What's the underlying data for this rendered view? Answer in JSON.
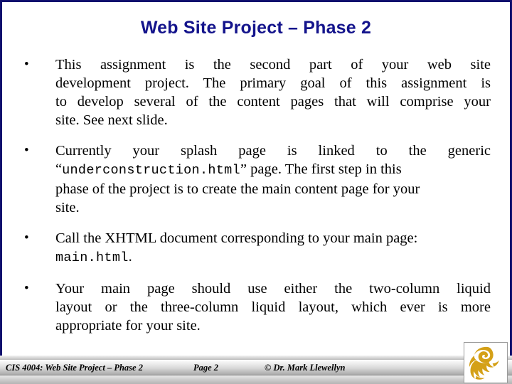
{
  "slide": {
    "title": "Web Site Project – Phase 2",
    "accent_color": "#14148c",
    "background_color": "#ffffff",
    "border_color": "#10106e",
    "bullet_glyph": "•",
    "bullets": [
      {
        "id": "bullet-1",
        "lines": [
          "This  assignment  is  the  second  part  of  your  web  site",
          "development project.  The primary goal of this assignment is",
          "to develop several of the content pages that will comprise your",
          "site.  See next slide."
        ],
        "plain": "This assignment is the second part of your web site development project.  The primary goal of this assignment is to develop several of the content pages that will comprise your site.  See next slide."
      },
      {
        "id": "bullet-2",
        "line1": "Currently  your  splash  page  is  linked  to  the  generic",
        "mono": "underconstruction.html",
        "line2_prefix": "“",
        "line2_suffix": "” page.  The first step in this",
        "line3": "phase of the project is to create the main content page for your",
        "line4": "site.",
        "plain": "Currently your splash page is linked to the generic “underconstruction.html” page.  The first step in this phase of the project is to create the main content page for your site."
      },
      {
        "id": "bullet-3",
        "line1": "Call the XHTML document corresponding to your main page:",
        "mono": "main.html",
        "line2_suffix": ".",
        "plain": "Call the XHTML document corresponding to your main page: main.html."
      },
      {
        "id": "bullet-4",
        "lines": [
          "Your  main  page  should  use  either  the  two-column  liquid",
          "layout or the three-column liquid layout, which ever is more",
          "appropriate for your site."
        ],
        "plain": "Your main page should use either the two-column liquid layout or the three-column liquid layout, which ever is more appropriate for your site."
      }
    ]
  },
  "footer": {
    "course": "CIS 4004: Web Site Project – Phase 2",
    "page": "Page 2",
    "copyright": "© Dr. Mark Llewellyn",
    "logo_name": "ucf-pegasus-logo",
    "logo_color": "#d4a017"
  }
}
